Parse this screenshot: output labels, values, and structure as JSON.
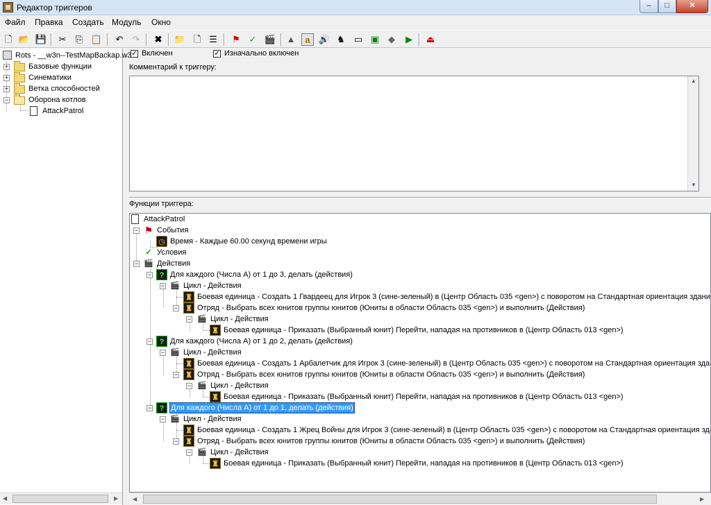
{
  "window": {
    "title": "Редактор триггеров",
    "min": "–",
    "max": "□",
    "close": "✕"
  },
  "menu": [
    "Файл",
    "Правка",
    "Создать",
    "Модуль",
    "Окно"
  ],
  "toolbar": [
    {
      "icon": "new-icon",
      "glyph": "🗋"
    },
    {
      "icon": "open-icon",
      "glyph": "📂"
    },
    {
      "icon": "save-icon",
      "glyph": "💾"
    },
    {
      "icon": "cut-icon",
      "glyph": "✂"
    },
    {
      "icon": "copy-icon",
      "glyph": "⎘"
    },
    {
      "icon": "paste-icon",
      "glyph": "📋"
    },
    {
      "icon": "undo-icon",
      "glyph": "↶"
    },
    {
      "icon": "redo-icon",
      "glyph": "↷"
    },
    {
      "icon": "delete-icon",
      "glyph": "✖"
    },
    {
      "icon": "new-category-icon",
      "glyph": "📁"
    },
    {
      "icon": "new-trigger-icon",
      "glyph": "🗋"
    },
    {
      "icon": "new-comment-icon",
      "glyph": "☰"
    },
    {
      "icon": "new-event-icon",
      "glyph": "⚑"
    },
    {
      "icon": "new-condition-icon",
      "glyph": "✓"
    },
    {
      "icon": "new-action-icon",
      "glyph": "🎬"
    },
    {
      "icon": "terrain-editor-icon",
      "glyph": "▲"
    },
    {
      "icon": "trigger-editor-icon",
      "glyph": "a"
    },
    {
      "icon": "sound-editor-icon",
      "glyph": "🔊"
    },
    {
      "icon": "object-editor-icon",
      "glyph": "♞"
    },
    {
      "icon": "campaign-editor-icon",
      "glyph": "▭"
    },
    {
      "icon": "ai-editor-icon",
      "glyph": "▣"
    },
    {
      "icon": "import-manager-icon",
      "glyph": "◆"
    },
    {
      "icon": "test-map-icon",
      "glyph": "▶"
    },
    {
      "icon": "exit-icon",
      "glyph": "⏏"
    }
  ],
  "tree": {
    "root": "Rots - __w3n--TestMapBackap.w3x",
    "categories": [
      "Базовые функции",
      "Синематики",
      "Ветка способностей",
      "Оборона котлов"
    ],
    "trigger": "AttackPatrol"
  },
  "options": {
    "enabled": "Включен",
    "initially_on": "Изначально включен"
  },
  "comment_label": "Комментарий к триггеру:",
  "functions_label": "Функции триггера:",
  "functions": {
    "trigger_name": "AttackPatrol",
    "events": "События",
    "event_1": "Время - Каждые 60.00 секунд времени игры",
    "conditions": "Условия",
    "actions": "Действия",
    "loop1": "Для каждого (Числа A) от 1 до 3, делать (действия)",
    "loop1_body": "Цикл - Действия",
    "loop1_create": "Боевая единица - Создать 1 Гвардеец для Игрок 3 (сине-зеленый) в (Центр Область 035 <gen>) с поворотом на Стандартная ориентация зданий",
    "loop1_group": "Отряд - Выбрать всех юнитов группы юнитов (Юниты в области Область 035 <gen>) и выполнить (Действия)",
    "loop1_inner": "Цикл - Действия",
    "loop1_order": "Боевая единица - Приказать (Выбранный юнит) Перейти, нападая на противников в (Центр Область 013 <gen>)",
    "loop2": "Для каждого (Числа A) от 1 до 2, делать (действия)",
    "loop2_body": "Цикл - Действия",
    "loop2_create": "Боевая единица - Создать 1 Арбалетчик для Игрок 3 (сине-зеленый) в (Центр Область 035 <gen>) с поворотом на Стандартная ориентация здан",
    "loop2_group": "Отряд - Выбрать всех юнитов группы юнитов (Юниты в области Область 035 <gen>) и выполнить (Действия)",
    "loop2_inner": "Цикл - Действия",
    "loop2_order": "Боевая единица - Приказать (Выбранный юнит) Перейти, нападая на противников в (Центр Область 013 <gen>)",
    "loop3": "Для каждого (Числа A) от 1 до 1, делать (действия)",
    "loop3_body": "Цикл - Действия",
    "loop3_create": "Боевая единица - Создать 1 Жрец Войны для Игрок 3 (сине-зеленый) в (Центр Область 035 <gen>) с поворотом на Стандартная ориентация здан",
    "loop3_group": "Отряд - Выбрать всех юнитов группы юнитов (Юниты в области Область 035 <gen>) и выполнить (Действия)",
    "loop3_inner": "Цикл - Действия",
    "loop3_order": "Боевая единица - Приказать (Выбранный юнит) Перейти, нападая на противников в (Центр Область 013 <gen>)"
  }
}
